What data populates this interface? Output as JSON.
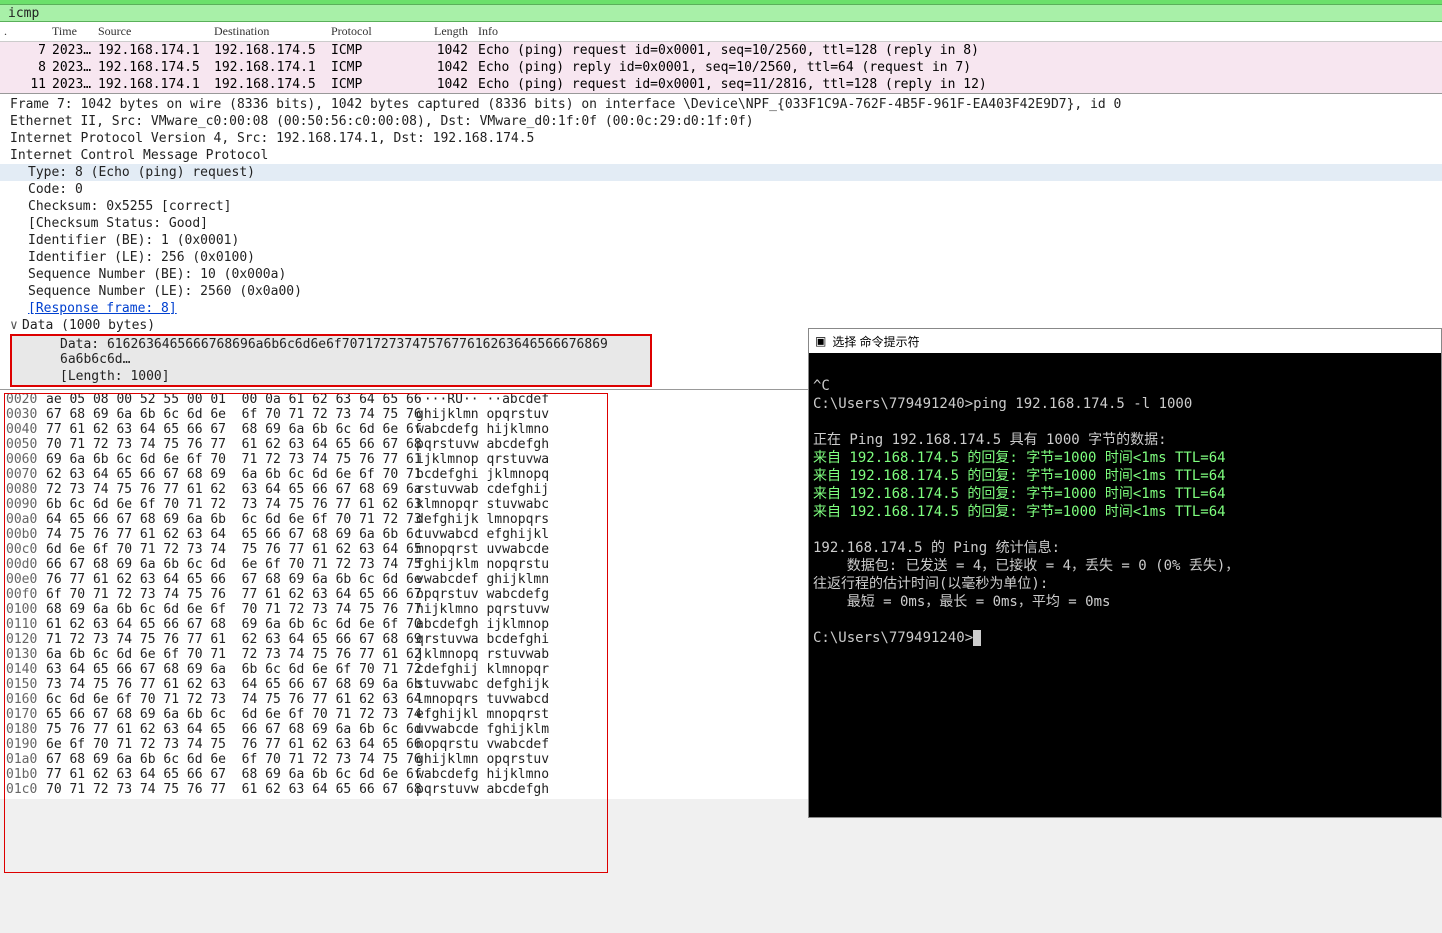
{
  "filter": {
    "value": "icmp"
  },
  "columns": {
    "no": ".",
    "time": "Time",
    "src": "Source",
    "dst": "Destination",
    "proto": "Protocol",
    "len": "Length",
    "info": "Info"
  },
  "packets": [
    {
      "no": "7",
      "time": "2023…",
      "src": "192.168.174.1",
      "dst": "192.168.174.5",
      "proto": "ICMP",
      "len": "1042",
      "info": "Echo (ping) request  id=0x0001, seq=10/2560, ttl=128 (reply in 8)"
    },
    {
      "no": "8",
      "time": "2023…",
      "src": "192.168.174.5",
      "dst": "192.168.174.1",
      "proto": "ICMP",
      "len": "1042",
      "info": "Echo (ping) reply    id=0x0001, seq=10/2560, ttl=64 (request in 7)"
    },
    {
      "no": "11",
      "time": "2023…",
      "src": "192.168.174.1",
      "dst": "192.168.174.5",
      "proto": "ICMP",
      "len": "1042",
      "info": "Echo (ping) request  id=0x0001, seq=11/2816, ttl=128 (reply in 12)"
    }
  ],
  "details": {
    "frame": "Frame 7: 1042 bytes on wire (8336 bits), 1042 bytes captured (8336 bits) on interface \\Device\\NPF_{033F1C9A-762F-4B5F-961F-EA403F42E9D7}, id 0",
    "eth": "Ethernet II, Src: VMware_c0:00:08 (00:50:56:c0:00:08), Dst: VMware_d0:1f:0f (00:0c:29:d0:1f:0f)",
    "ip": "Internet Protocol Version 4, Src: 192.168.174.1, Dst: 192.168.174.5",
    "icmp": "Internet Control Message Protocol",
    "type": "Type: 8 (Echo (ping) request)",
    "code": "Code: 0",
    "checksum": "Checksum: 0x5255 [correct]",
    "checksum_status": "[Checksum Status: Good]",
    "id_be": "Identifier (BE): 1 (0x0001)",
    "id_le": "Identifier (LE): 256 (0x0100)",
    "seq_be": "Sequence Number (BE): 10 (0x000a)",
    "seq_le": "Sequence Number (LE): 2560 (0x0a00)",
    "resp_frame": "[Response frame: 8]",
    "data_header": "Data (1000 bytes)",
    "data_value": "Data: 6162636465666768696a6b6c6d6e6f7071727374757677616263646566676869​6a6b6c6d…",
    "data_length": "[Length: 1000]"
  },
  "hex": [
    {
      "off": "0020",
      "bytes": "ae 05 08 00 52 55 00 01  00 0a 61 62 63 64 65 66",
      "ascii": "····RU·· ··abcdef"
    },
    {
      "off": "0030",
      "bytes": "67 68 69 6a 6b 6c 6d 6e  6f 70 71 72 73 74 75 76",
      "ascii": "ghijklmn opqrstuv"
    },
    {
      "off": "0040",
      "bytes": "77 61 62 63 64 65 66 67  68 69 6a 6b 6c 6d 6e 6f",
      "ascii": "wabcdefg hijklmno"
    },
    {
      "off": "0050",
      "bytes": "70 71 72 73 74 75 76 77  61 62 63 64 65 66 67 68",
      "ascii": "pqrstuvw abcdefgh"
    },
    {
      "off": "0060",
      "bytes": "69 6a 6b 6c 6d 6e 6f 70  71 72 73 74 75 76 77 61",
      "ascii": "ijklmnop qrstuvwa"
    },
    {
      "off": "0070",
      "bytes": "62 63 64 65 66 67 68 69  6a 6b 6c 6d 6e 6f 70 71",
      "ascii": "bcdefghi jklmnopq"
    },
    {
      "off": "0080",
      "bytes": "72 73 74 75 76 77 61 62  63 64 65 66 67 68 69 6a",
      "ascii": "rstuvwab cdefghij"
    },
    {
      "off": "0090",
      "bytes": "6b 6c 6d 6e 6f 70 71 72  73 74 75 76 77 61 62 63",
      "ascii": "klmnopqr stuvwabc"
    },
    {
      "off": "00a0",
      "bytes": "64 65 66 67 68 69 6a 6b  6c 6d 6e 6f 70 71 72 73",
      "ascii": "defghijk lmnopqrs"
    },
    {
      "off": "00b0",
      "bytes": "74 75 76 77 61 62 63 64  65 66 67 68 69 6a 6b 6c",
      "ascii": "tuvwabcd efghijkl"
    },
    {
      "off": "00c0",
      "bytes": "6d 6e 6f 70 71 72 73 74  75 76 77 61 62 63 64 65",
      "ascii": "mnopqrst uvwabcde"
    },
    {
      "off": "00d0",
      "bytes": "66 67 68 69 6a 6b 6c 6d  6e 6f 70 71 72 73 74 75",
      "ascii": "fghijklm nopqrstu"
    },
    {
      "off": "00e0",
      "bytes": "76 77 61 62 63 64 65 66  67 68 69 6a 6b 6c 6d 6e",
      "ascii": "vwabcdef ghijklmn"
    },
    {
      "off": "00f0",
      "bytes": "6f 70 71 72 73 74 75 76  77 61 62 63 64 65 66 67",
      "ascii": "opqrstuv wabcdefg"
    },
    {
      "off": "0100",
      "bytes": "68 69 6a 6b 6c 6d 6e 6f  70 71 72 73 74 75 76 77",
      "ascii": "hijklmno pqrstuvw"
    },
    {
      "off": "0110",
      "bytes": "61 62 63 64 65 66 67 68  69 6a 6b 6c 6d 6e 6f 70",
      "ascii": "abcdefgh ijklmnop"
    },
    {
      "off": "0120",
      "bytes": "71 72 73 74 75 76 77 61  62 63 64 65 66 67 68 69",
      "ascii": "qrstuvwa bcdefghi"
    },
    {
      "off": "0130",
      "bytes": "6a 6b 6c 6d 6e 6f 70 71  72 73 74 75 76 77 61 62",
      "ascii": "jklmnopq rstuvwab"
    },
    {
      "off": "0140",
      "bytes": "63 64 65 66 67 68 69 6a  6b 6c 6d 6e 6f 70 71 72",
      "ascii": "cdefghij klmnopqr"
    },
    {
      "off": "0150",
      "bytes": "73 74 75 76 77 61 62 63  64 65 66 67 68 69 6a 6b",
      "ascii": "stuvwabc defghijk"
    },
    {
      "off": "0160",
      "bytes": "6c 6d 6e 6f 70 71 72 73  74 75 76 77 61 62 63 64",
      "ascii": "lmnopqrs tuvwabcd"
    },
    {
      "off": "0170",
      "bytes": "65 66 67 68 69 6a 6b 6c  6d 6e 6f 70 71 72 73 74",
      "ascii": "efghijkl mnopqrst"
    },
    {
      "off": "0180",
      "bytes": "75 76 77 61 62 63 64 65  66 67 68 69 6a 6b 6c 6d",
      "ascii": "uvwabcde fghijklm"
    },
    {
      "off": "0190",
      "bytes": "6e 6f 70 71 72 73 74 75  76 77 61 62 63 64 65 66",
      "ascii": "nopqrstu vwabcdef"
    },
    {
      "off": "01a0",
      "bytes": "67 68 69 6a 6b 6c 6d 6e  6f 70 71 72 73 74 75 76",
      "ascii": "ghijklmn opqrstuv"
    },
    {
      "off": "01b0",
      "bytes": "77 61 62 63 64 65 66 67  68 69 6a 6b 6c 6d 6e 6f",
      "ascii": "wabcdefg hijklmno"
    },
    {
      "off": "01c0",
      "bytes": "70 71 72 73 74 75 76 77  61 62 63 64 65 66 67 68",
      "ascii": "pqrstuvw abcdefgh"
    }
  ],
  "cmd": {
    "title": "选择 命令提示符",
    "line_ctrlc": "^C",
    "prompt1": "C:\\Users\\779491240>ping 192.168.174.5 -l 1000",
    "blank": "",
    "ping_header": "正在 Ping 192.168.174.5 具有 1000 字节的数据:",
    "reply1": "来自 192.168.174.5 的回复: 字节=1000 时间<1ms TTL=64",
    "reply2": "来自 192.168.174.5 的回复: 字节=1000 时间<1ms TTL=64",
    "reply3": "来自 192.168.174.5 的回复: 字节=1000 时间<1ms TTL=64",
    "reply4": "来自 192.168.174.5 的回复: 字节=1000 时间<1ms TTL=64",
    "stats1": "192.168.174.5 的 Ping 统计信息:",
    "stats2": "    数据包: 已发送 = 4，已接收 = 4，丢失 = 0 (0% 丢失)，",
    "stats3": "往返行程的估计时间(以毫秒为单位):",
    "stats4": "    最短 = 0ms，最长 = 0ms，平均 = 0ms",
    "prompt2": "C:\\Users\\779491240>"
  }
}
